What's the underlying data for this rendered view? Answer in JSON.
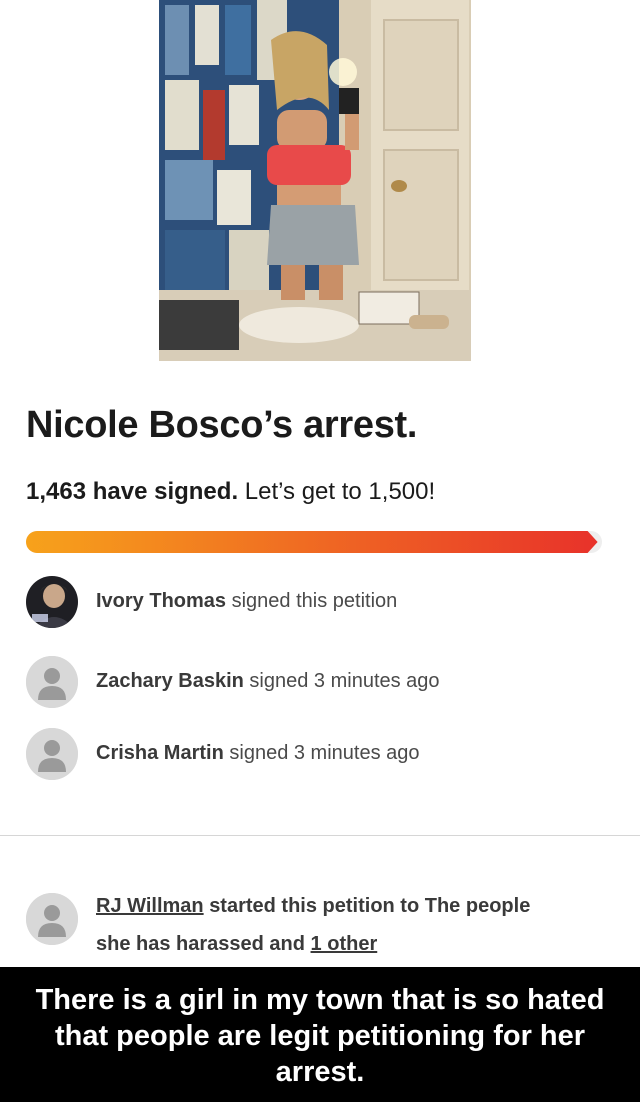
{
  "petition": {
    "title": "Nicole Bosco’s arrest.",
    "signed_count_text": "1,463 have signed.",
    "goal_text": "Let’s get to 1,500!",
    "progress_fraction": 0.975
  },
  "signers": [
    {
      "name": "Ivory Thomas",
      "action": "signed this petition",
      "avatar": "profile-photo"
    },
    {
      "name": "Zachary Baskin",
      "action": "signed 3 minutes ago",
      "avatar": "default-person-icon"
    },
    {
      "name": "Crisha Martin",
      "action": "signed 3 minutes ago",
      "avatar": "default-person-icon"
    }
  ],
  "starter": {
    "name": "RJ Willman",
    "middle_text": "started this petition to The people",
    "line2_text": "she has harassed and",
    "other_link": "1 other"
  },
  "caption": {
    "line1": "There is a girl in my town that is so hated",
    "line2": "that people are legit petitioning for her",
    "line3": "arrest."
  },
  "colors": {
    "progress_start": "#f7a21b",
    "progress_end": "#e8322a",
    "avatar_bg": "#d8d8d8",
    "avatar_icon": "#9a9a9a"
  }
}
